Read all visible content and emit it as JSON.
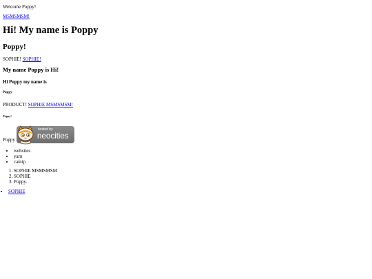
{
  "welcome": "Welcome Poppy!",
  "top_link": "MSMSMSM!",
  "h1": "Hi! My name is Poppy",
  "h2": "Poppy!",
  "sophie_line": {
    "text": "SOPHIE!",
    "link": "SOPHIE!"
  },
  "h3": "My name Poppy is Hi!",
  "h4": "Hi Poppy my name is",
  "h5": "Poppy",
  "product_line": {
    "text": "PRODUCT!",
    "link": "SOPHIE MSMSMSM!"
  },
  "h6": "Poppy!",
  "image_line": {
    "text": "Poppy",
    "badge": {
      "hosted": "hosted by",
      "brand": "neocities",
      "icon": "neocities-cat-icon"
    }
  },
  "unordered_list": [
    "websites",
    "yarn",
    "catnip"
  ],
  "ordered_list": [
    "SOPHIE MSMSMSM",
    "SOPHIE",
    "Poppy."
  ],
  "link_list": [
    "SOPHIE"
  ],
  "colors": {
    "link": "#0000ee",
    "badge": "#7a7a7a"
  }
}
